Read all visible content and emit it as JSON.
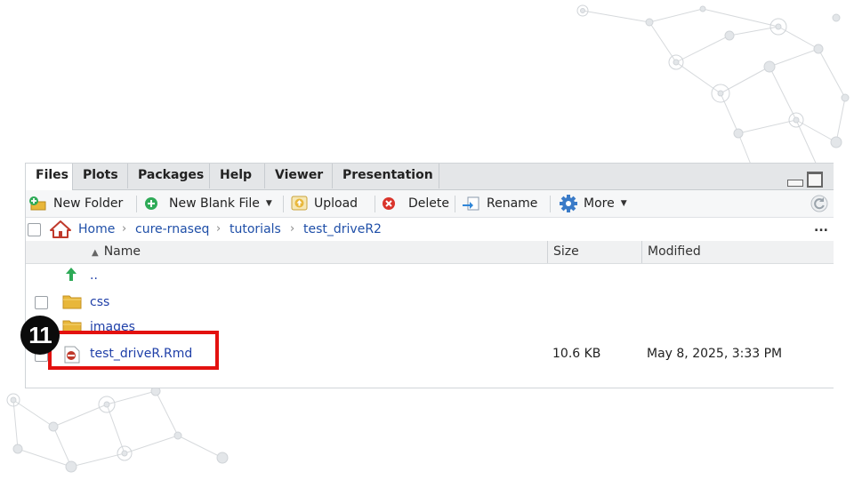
{
  "tabs": [
    {
      "label": "Files",
      "active": true
    },
    {
      "label": "Plots",
      "active": false
    },
    {
      "label": "Packages",
      "active": false
    },
    {
      "label": "Help",
      "active": false
    },
    {
      "label": "Viewer",
      "active": false
    },
    {
      "label": "Presentation",
      "active": false
    }
  ],
  "toolbar": {
    "new_folder": "New Folder",
    "new_blank_file": "New Blank File",
    "upload": "Upload",
    "delete": "Delete",
    "rename": "Rename",
    "more": "More"
  },
  "breadcrumb": [
    "Home",
    "cure-rnaseq",
    "tutorials",
    "test_driveR2"
  ],
  "overflow_label": "...",
  "columns": {
    "name": "Name",
    "size": "Size",
    "modified": "Modified"
  },
  "parent_dir": "..",
  "files": [
    {
      "name": "css",
      "type": "folder",
      "size": "",
      "modified": ""
    },
    {
      "name": "images",
      "type": "folder",
      "size": "",
      "modified": ""
    },
    {
      "name": "test_driveR.Rmd",
      "type": "rmd",
      "size": "10.6 KB",
      "modified": "May 8, 2025, 3:33 PM"
    }
  ],
  "annotation": {
    "step": "11",
    "color": "#e3110f"
  },
  "colors": {
    "link": "#1f3fa8",
    "folder": "#e8b73a",
    "up_arrow": "#2eaa57"
  }
}
